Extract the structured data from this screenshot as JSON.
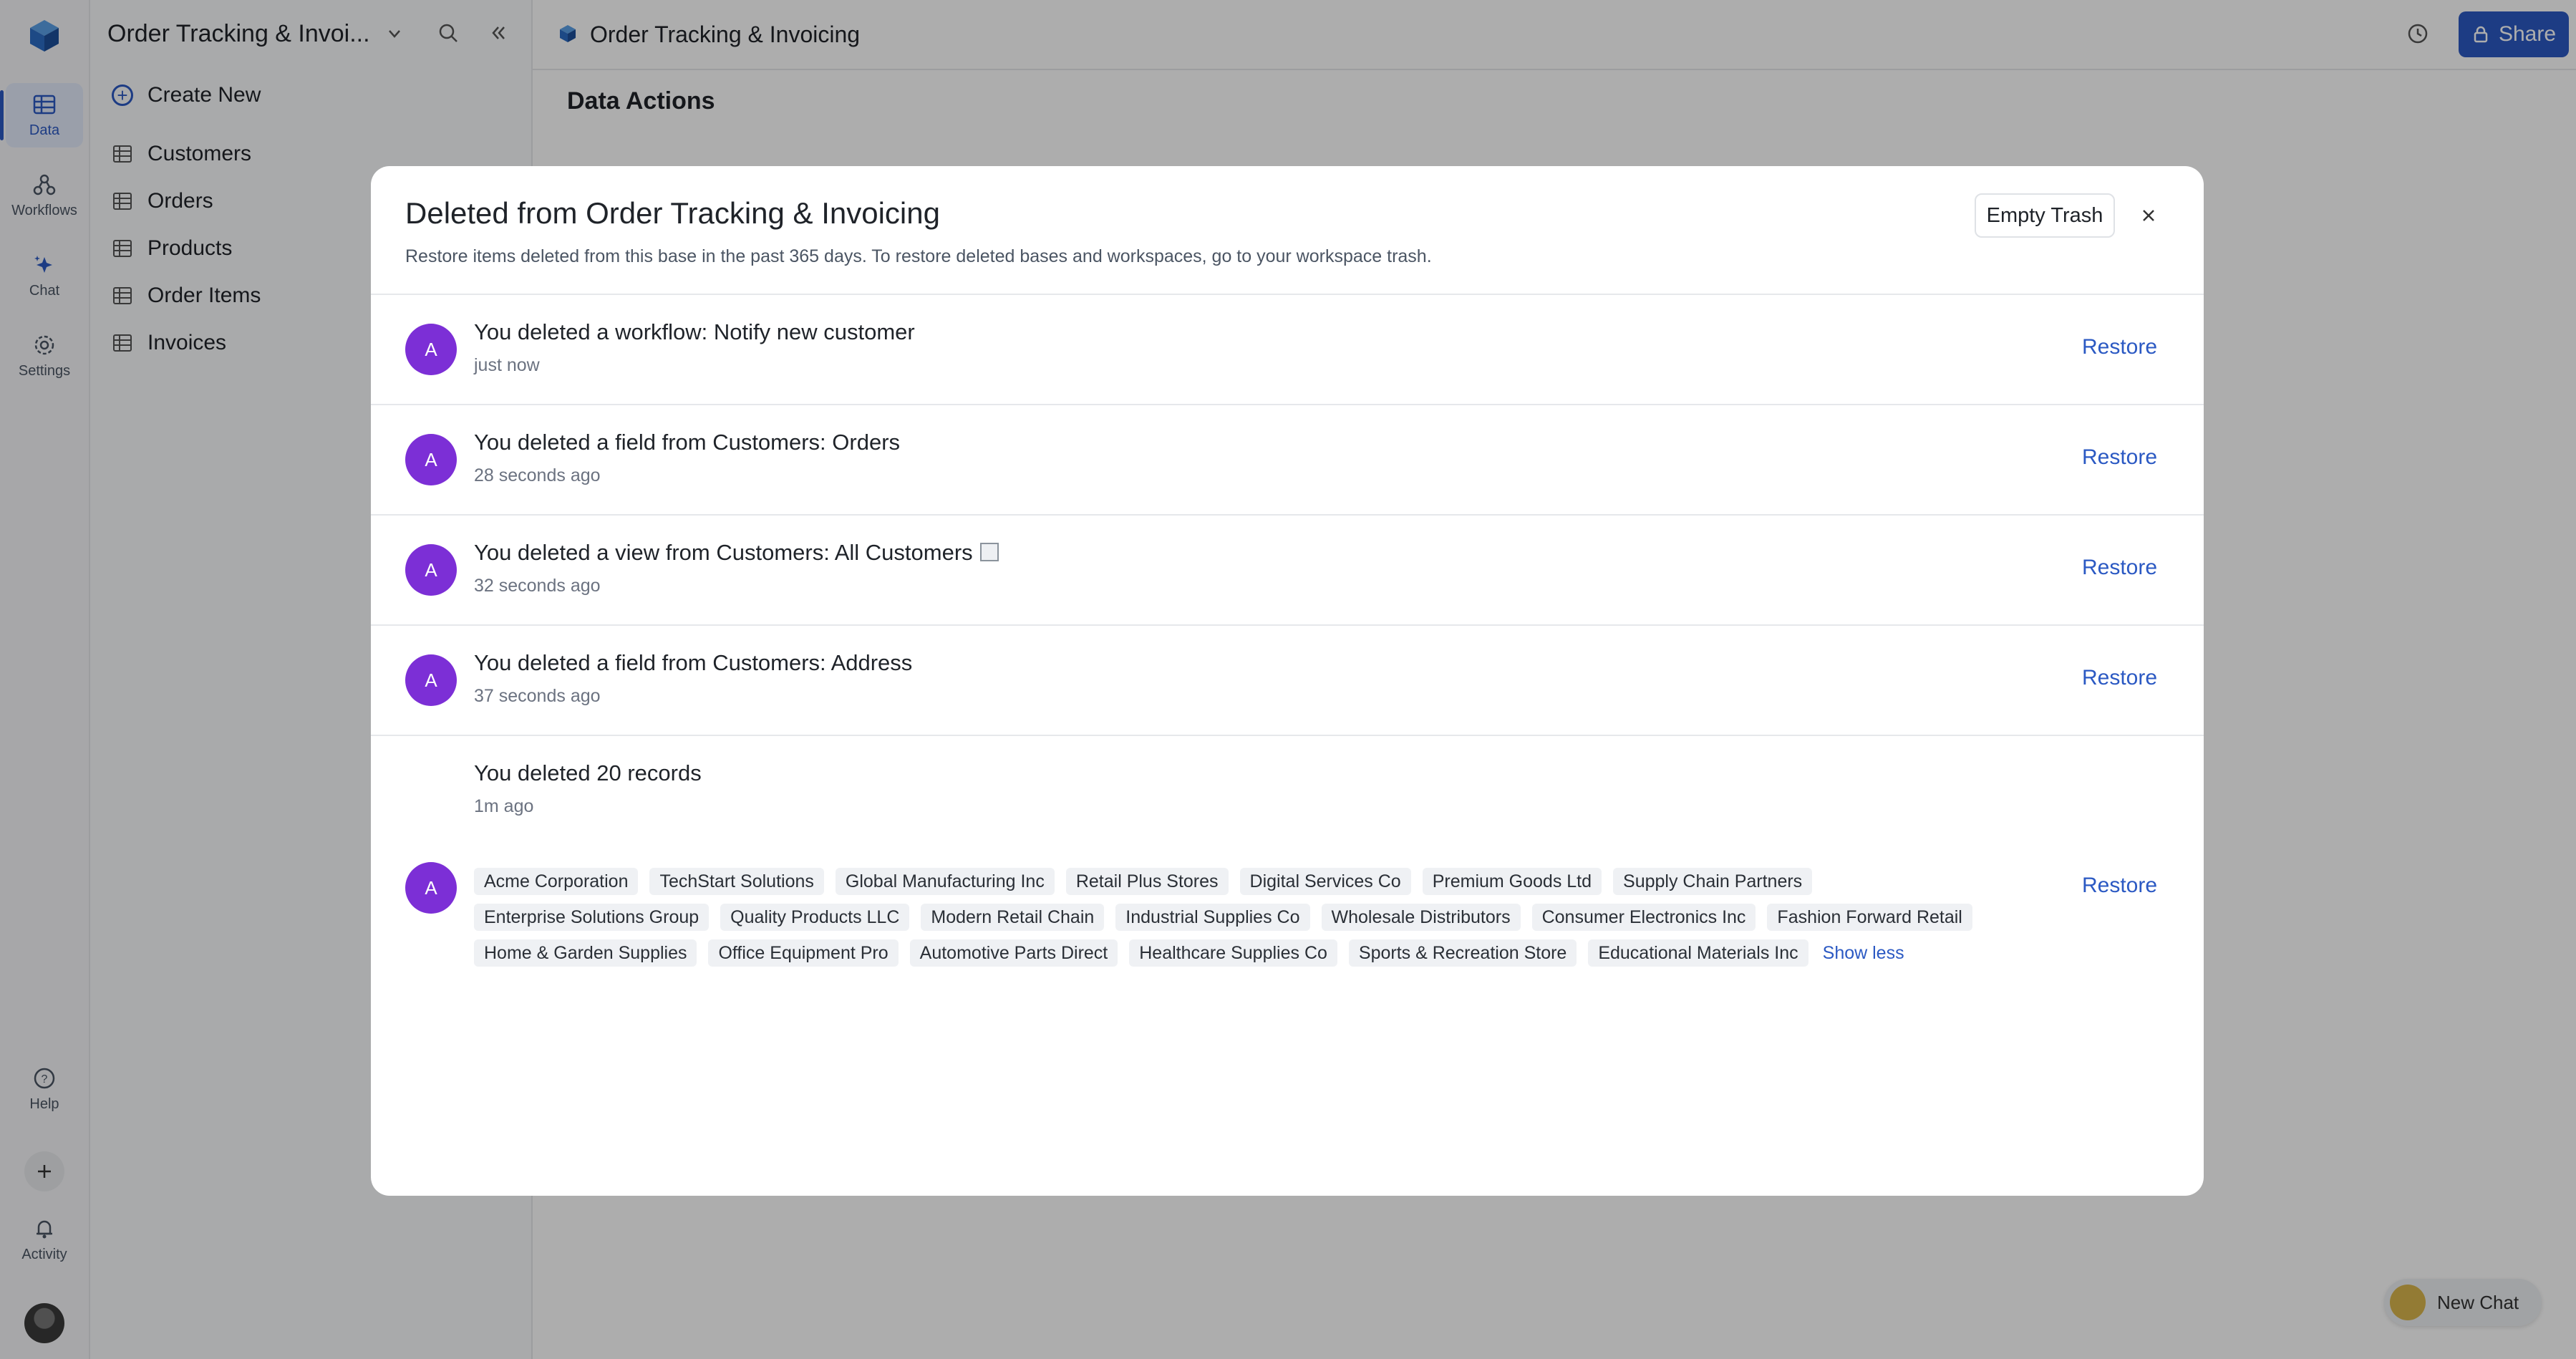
{
  "rail": {
    "items": [
      {
        "label": "Data",
        "icon": "table-icon"
      },
      {
        "label": "Workflows",
        "icon": "workflow-icon"
      },
      {
        "label": "Chat",
        "icon": "sparkle-icon"
      },
      {
        "label": "Settings",
        "icon": "gear-icon"
      }
    ],
    "help_label": "Help",
    "activity_label": "Activity"
  },
  "sidebar": {
    "title": "Order Tracking & Invoi...",
    "create_label": "Create New",
    "tables": [
      "Customers",
      "Orders",
      "Products",
      "Order Items",
      "Invoices"
    ]
  },
  "topbar": {
    "title": "Order Tracking & Invoicing",
    "share_label": "Share"
  },
  "main": {
    "heading": "Data Actions",
    "new_chat_label": "New Chat"
  },
  "modal": {
    "title": "Deleted from Order Tracking & Invoicing",
    "subtitle": "Restore items deleted from this base in the past 365 days. To restore deleted bases and workspaces, go to your workspace trash.",
    "empty_trash_label": "Empty Trash",
    "restore_label": "Restore",
    "avatar_initial": "A",
    "items": [
      {
        "title": "You deleted a workflow: Notify new customer",
        "time": "just now"
      },
      {
        "title": "You deleted a field from Customers: Orders",
        "time": "28 seconds ago"
      },
      {
        "title": "You deleted a view from Customers: All Customers",
        "time": "32 seconds ago"
      },
      {
        "title": "You deleted a field from Customers: Address",
        "time": "37 seconds ago"
      }
    ],
    "records": {
      "title": "You deleted 20 records",
      "time": "1m ago",
      "tags": [
        "Acme Corporation",
        "TechStart Solutions",
        "Global Manufacturing Inc",
        "Retail Plus Stores",
        "Digital Services Co",
        "Premium Goods Ltd",
        "Supply Chain Partners",
        "Enterprise Solutions Group",
        "Quality Products LLC",
        "Modern Retail Chain",
        "Industrial Supplies Co",
        "Wholesale Distributors",
        "Consumer Electronics Inc",
        "Fashion Forward Retail",
        "Home & Garden Supplies",
        "Office Equipment Pro",
        "Automotive Parts Direct",
        "Healthcare Supplies Co",
        "Sports & Recreation Store",
        "Educational Materials Inc"
      ],
      "show_less_label": "Show less"
    }
  },
  "colors": {
    "accent": "#2b59c3",
    "avatar": "#7c2fd6"
  }
}
